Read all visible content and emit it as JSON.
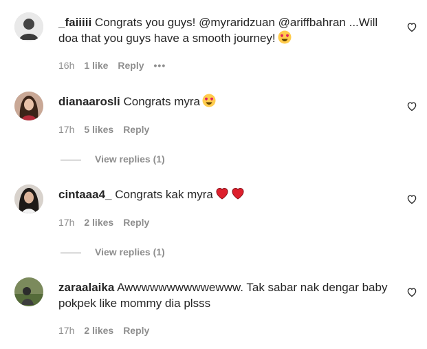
{
  "comments": [
    {
      "username": "_faiiiii",
      "text_pre": " Congrats you guys! ",
      "mention1": "@myraridzuan",
      "mention2": "@ariffbahran",
      "text_post": " ...Will doa that you guys have a smooth journey!",
      "emoji": "heart-eyes-emoji",
      "time": "16h",
      "likes": "1 like",
      "reply": "Reply",
      "more": "•••"
    },
    {
      "username": "dianaarosli",
      "text": " Congrats myra",
      "emoji": "heart-eyes-emoji",
      "time": "17h",
      "likes": "5 likes",
      "reply": "Reply",
      "view_replies": "View replies (1)"
    },
    {
      "username": "cintaaa4_",
      "text": " Congrats kak myra",
      "emoji": "red-heart-emoji",
      "time": "17h",
      "likes": "2 likes",
      "reply": "Reply",
      "view_replies": "View replies (1)"
    },
    {
      "username": "zaraalaika",
      "text": " Awwwwwwwwwwewww. Tak sabar nak dengar baby pokpek like mommy dia plsss",
      "time": "17h",
      "likes": "2 likes",
      "reply": "Reply"
    }
  ],
  "colors": {
    "text": "#262626",
    "secondary": "#8e8e8e",
    "heart_red": "#e0245e"
  },
  "icons": [
    "heart-outline-icon",
    "heart-eyes-emoji",
    "red-heart-emoji"
  ]
}
